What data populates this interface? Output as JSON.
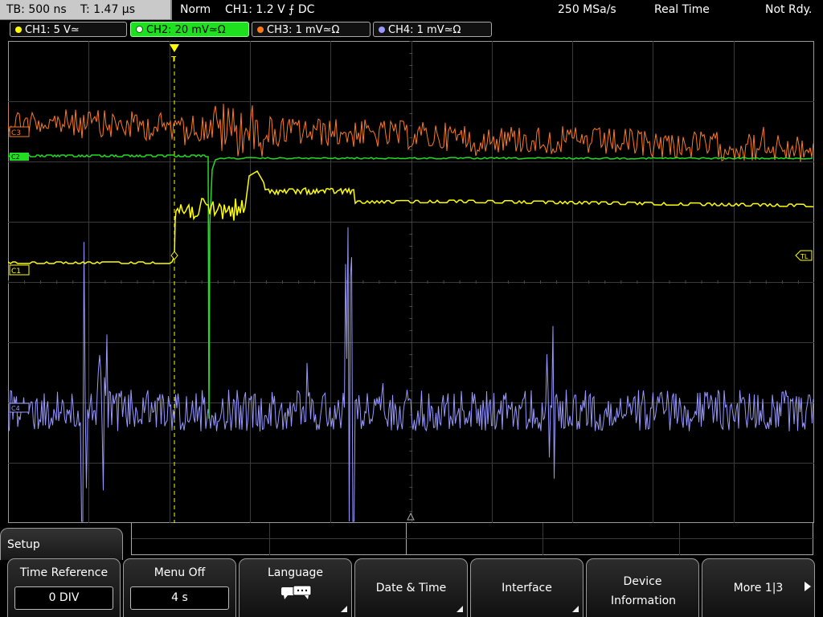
{
  "topbar": {
    "timebase": "TB: 500 ns",
    "trigger_time": "T: 1.47 µs",
    "trigger_mode": "Norm",
    "trigger_setting": "CH1: 1.2 V ⨍ DC",
    "sample_rate": "250 MSa/s",
    "acq_mode": "Real Time",
    "status": "Not Rdy."
  },
  "channels": [
    {
      "label": "CH1: 5 V≃",
      "color": "#ffff00"
    },
    {
      "label": "CH2: 20 mV≃Ω",
      "color": "#22dd22"
    },
    {
      "label": "CH3: 1 mV≃Ω",
      "color": "#ff7a1a"
    },
    {
      "label": "CH4: 1 mV≃Ω",
      "color": "#9898ff"
    }
  ],
  "markers": {
    "c3": "C3",
    "c2": "C2",
    "c1": "C1",
    "c4": "C4",
    "trigger_level": "TL",
    "trigger_pos": "T"
  },
  "menu": {
    "title": "Setup",
    "softkeys": [
      {
        "label": "Time Reference",
        "value": "0 DIV"
      },
      {
        "label": "Menu Off",
        "value": "4 s"
      },
      {
        "label": "Language",
        "icon": "speech-bubbles-icon"
      },
      {
        "label": "Date & Time"
      },
      {
        "label": "Interface"
      },
      {
        "label": "Device Information"
      },
      {
        "label": "More 1|3"
      }
    ]
  }
}
